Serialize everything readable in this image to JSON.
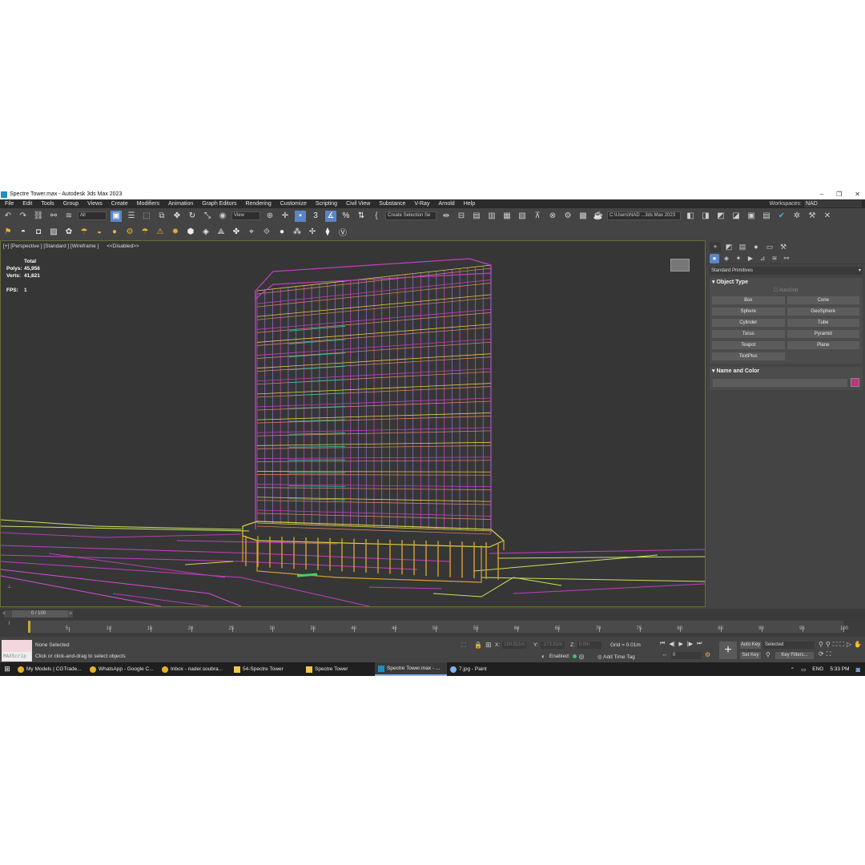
{
  "window": {
    "title": "Spectre Tower.max - Autodesk 3ds Max 2023"
  },
  "menu": [
    "File",
    "Edit",
    "Tools",
    "Group",
    "Views",
    "Create",
    "Modifiers",
    "Animation",
    "Graph Editors",
    "Rendering",
    "Customize",
    "Scripting",
    "Civil View",
    "Substance",
    "V-Ray",
    "Arnold",
    "Help"
  ],
  "workspaces": {
    "label": "Workspaces:",
    "value": "NAD"
  },
  "toolbar": {
    "filter": "All",
    "ref_coord": "View",
    "named_sel": "Create Selection Se",
    "path": "C:\\Users\\NAD ...3ds Max 2023"
  },
  "viewport": {
    "label": "[+] [Perspective ] [Standard ] [Wireframe ]",
    "filter": "<<Disabled>>",
    "stats_total": "Total",
    "polys_label": "Polys:",
    "polys_value": "45,956",
    "verts_label": "Verts:",
    "verts_value": "41,821",
    "fps_label": "FPS:",
    "fps_value": "1"
  },
  "command_panel": {
    "category": "Standard Primitives",
    "object_type_title": "Object Type",
    "autogrid": "AutoGrid",
    "buttons": [
      "Box",
      "Cone",
      "Sphere",
      "GeoSphere",
      "Cylinder",
      "Tube",
      "Torus",
      "Pyramid",
      "Teapot",
      "Plane",
      "TextPlus"
    ],
    "name_color_title": "Name and Color",
    "object_color": "#c0357d"
  },
  "timeline": {
    "slider": "0 / 100",
    "ticks": [
      "5",
      "10",
      "15",
      "20",
      "25",
      "30",
      "35",
      "40",
      "45",
      "50",
      "55",
      "60",
      "65",
      "70",
      "75",
      "80",
      "85",
      "90",
      "95",
      "100"
    ]
  },
  "status": {
    "maxscript": "MAXScrip",
    "selection": "None Selected",
    "prompt": "Click or click-and-drag to select objects",
    "x_label": "X:",
    "x_value": "150.511m",
    "y_label": "Y:",
    "y_value": "-173.51m",
    "z_label": "Z:",
    "z_value": "0.0m",
    "grid": "Grid = 0.01m",
    "enabled": "Enabled:",
    "add_time_tag": "Add Time Tag",
    "frame": "0",
    "auto_key": "Auto Key",
    "set_key": "Set Key",
    "selected": "Selected",
    "key_filters": "Key Filters..."
  },
  "taskbar": {
    "apps": [
      {
        "label": "My Models | CGTrade...",
        "color": "#e5b32a"
      },
      {
        "label": "WhatsApp - Google C...",
        "color": "#e5b32a"
      },
      {
        "label": "Inbox - nader.soubra...",
        "color": "#e5b32a"
      },
      {
        "label": "54-Spectre Tower",
        "color": "#f0c94d"
      },
      {
        "label": "Spectre Tower",
        "color": "#f0c94d"
      },
      {
        "label": "Spectre Tower.max - ...",
        "color": "#1e8fbf"
      },
      {
        "label": "7.jpg - Paint",
        "color": "#7fb5e8"
      }
    ],
    "lang": "ENG",
    "time": "5:33 PM"
  }
}
